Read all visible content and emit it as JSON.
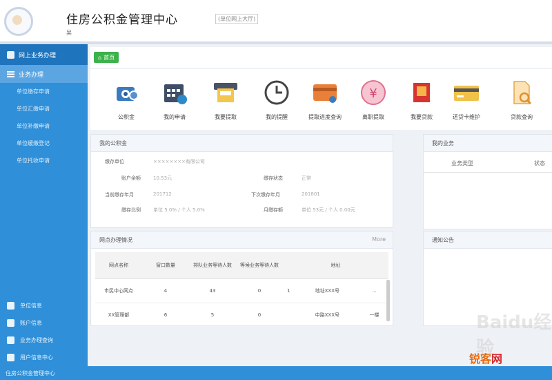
{
  "header": {
    "title": "住房公积金管理中心",
    "subtitle": "(单位网上大厅)",
    "user": "吴"
  },
  "sidebar": {
    "top_label": "网上业务办理",
    "section_label": "业务办理",
    "items": [
      {
        "label": "单位缴存申请"
      },
      {
        "label": "单位汇缴申请"
      },
      {
        "label": "单位补缴申请"
      },
      {
        "label": "单位缓缴登记"
      },
      {
        "label": "单位托收申请"
      }
    ],
    "bottom": [
      {
        "label": "单位信息"
      },
      {
        "label": "账户信息"
      },
      {
        "label": "业务办理查询"
      },
      {
        "label": "用户信息中心"
      }
    ]
  },
  "toolbar": {
    "home_label": "首页"
  },
  "icon_bar": [
    {
      "label": "公积金",
      "icon": "camera-icon"
    },
    {
      "label": "我的申请",
      "icon": "calendar-icon"
    },
    {
      "label": "我要提取",
      "icon": "atm-icon"
    },
    {
      "label": "我的提醒",
      "icon": "clock-icon"
    },
    {
      "label": "提取进度查询",
      "icon": "card-icon"
    },
    {
      "label": "离职提取",
      "icon": "yen-icon"
    },
    {
      "label": "我要贷款",
      "icon": "gift-icon"
    },
    {
      "label": "还贷卡维护",
      "icon": "bankcard-icon"
    },
    {
      "label": "贷款查询",
      "icon": "document-search-icon"
    }
  ],
  "account_panel": {
    "title": "我的公积金",
    "fields": [
      {
        "label": "缴存单位",
        "value": "××××××××有限公司"
      },
      {
        "label": "账户余额",
        "value": "10.53元"
      },
      {
        "label": "缴存状态",
        "value": "正常"
      },
      {
        "label": "当前缴存年月",
        "value": "201712"
      },
      {
        "label": "下次缴存年月",
        "value": "201801"
      },
      {
        "label": "缴存比例",
        "value": "单位 5.0% / 个人 5.0%"
      },
      {
        "label": "月缴存额",
        "value": "单位 53元 / 个人 0.00元"
      }
    ]
  },
  "business_panel": {
    "title": "我的业务",
    "col1": "业务类型",
    "col2": "状态"
  },
  "status_panel": {
    "title": "网点办理情况",
    "more": "More",
    "headers": [
      "网点名称",
      "窗口数量",
      "排队业务等待人数",
      "等候业务等待人数",
      "地址"
    ],
    "rows": [
      [
        "市民中心网点",
        "4",
        "43",
        "0",
        "1",
        "地址XXX号",
        "..."
      ],
      [
        "XX管理部",
        "6",
        "5",
        "0",
        "",
        "中路XXX号",
        "一楼"
      ]
    ]
  },
  "notice_panel": {
    "title": "通知公告"
  },
  "footer": "住房公积金管理中心",
  "watermark": {
    "text": "Baidu经验",
    "brand_a": "锐客",
    "brand_b": "网"
  }
}
